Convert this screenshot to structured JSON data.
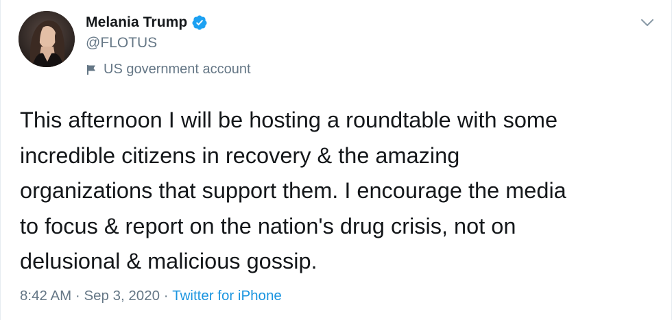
{
  "tweet": {
    "author": {
      "display_name": "Melania Trump",
      "handle": "@FLOTUS",
      "verified": true,
      "account_label": "US government account"
    },
    "text": "This afternoon I will be hosting a roundtable with some\nincredible citizens in recovery & the amazing\norganizations that support them. I encourage the media\nto focus & report on the nation's drug crisis, not on\ndelusional & malicious gossip.",
    "meta": {
      "time": "8:42 AM",
      "separator_1": " · ",
      "date": "Sep 3, 2020",
      "separator_2": " · ",
      "source": "Twitter for iPhone"
    }
  },
  "icons": {
    "verified": "verified-badge-icon",
    "account_label": "flag-icon",
    "menu": "chevron-down-icon"
  },
  "colors": {
    "primary_text": "#14171a",
    "secondary_text": "#657786",
    "link": "#1b95e0",
    "verified_badge": "#1da1f2",
    "border": "#e6ecf0"
  }
}
